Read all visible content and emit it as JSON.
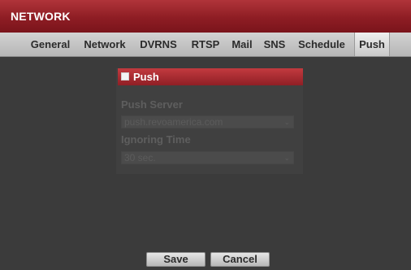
{
  "window": {
    "title": "NETWORK"
  },
  "tabs": [
    {
      "label": "General"
    },
    {
      "label": "Network"
    },
    {
      "label": "DVRNS"
    },
    {
      "label": "RTSP"
    },
    {
      "label": "Mail"
    },
    {
      "label": "SNS"
    },
    {
      "label": "Schedule"
    },
    {
      "label": "Push",
      "active": true
    }
  ],
  "push": {
    "checkbox_label": "Push",
    "checked": false,
    "server_label": "Push Server",
    "server_value": "push.revoamerica.com",
    "ignoring_time_label": "Ignoring Time",
    "ignoring_time_value": "30 sec."
  },
  "buttons": {
    "save": "Save",
    "cancel": "Cancel"
  },
  "colors": {
    "title_bar": "#8e1d24",
    "panel_header": "#b0343a",
    "background": "#3b3b3b",
    "tab_bar": "#c4c4c4"
  }
}
